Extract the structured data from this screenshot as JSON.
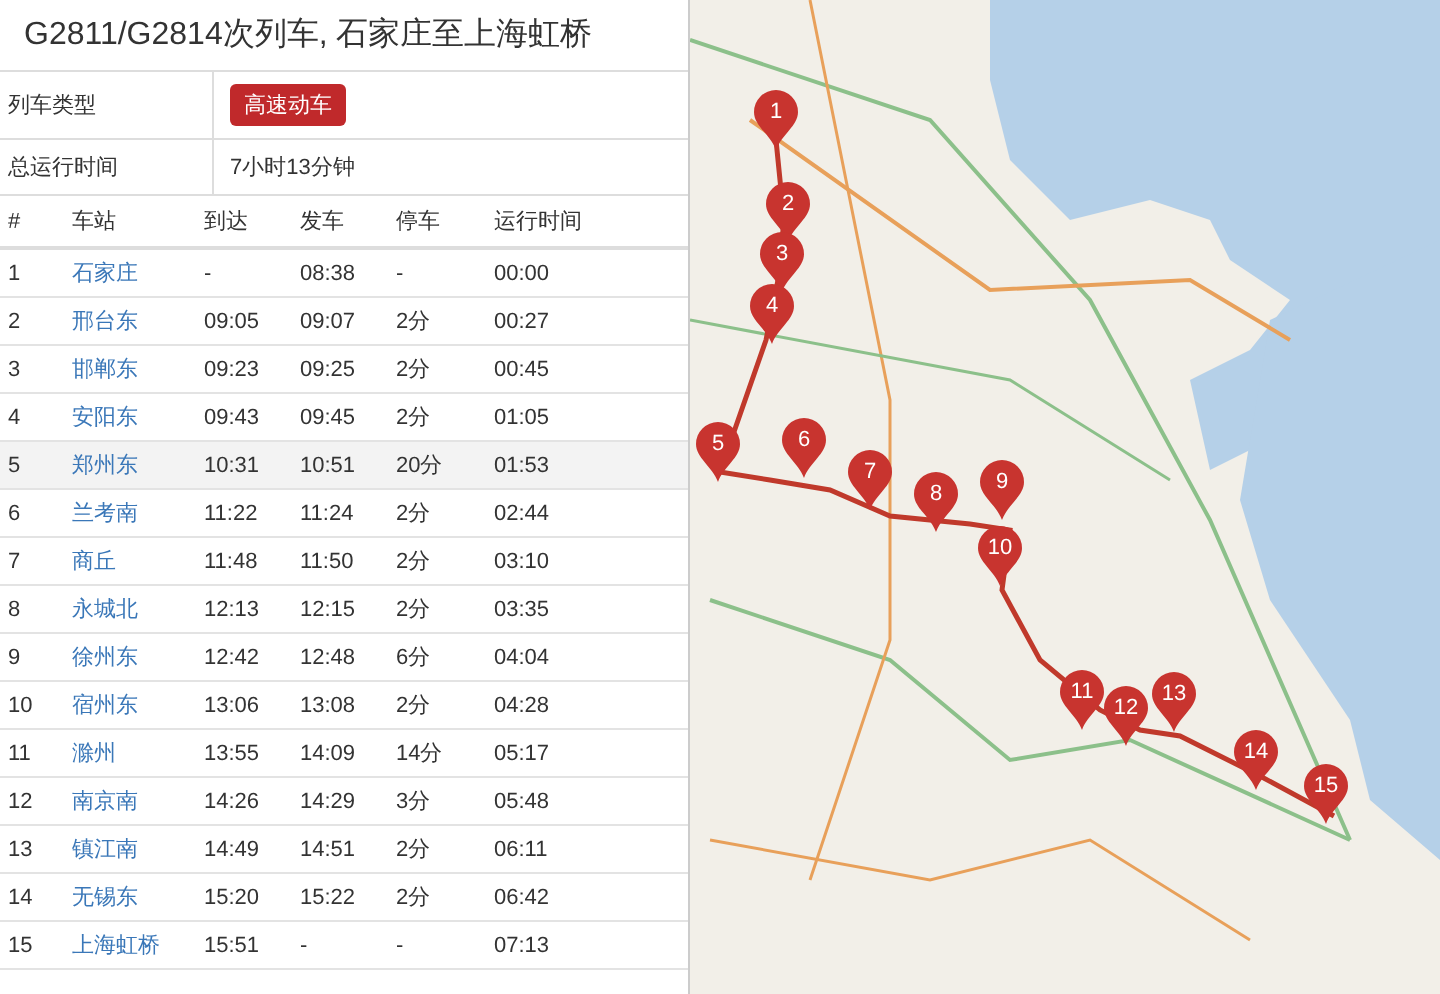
{
  "title": "G2811/G2814次列车, 石家庄至上海虹桥",
  "info": [
    {
      "label": "列车类型",
      "value": "高速动车",
      "kind": "badge"
    },
    {
      "label": "总运行时间",
      "value": "7小时13分钟",
      "kind": "text"
    }
  ],
  "table": {
    "columns": [
      "#",
      "车站",
      "到达",
      "发车",
      "停车",
      "运行时间"
    ],
    "rows": [
      {
        "cells": [
          "1",
          "石家庄",
          "-",
          "08:38",
          "-",
          "00:00"
        ],
        "selected": false
      },
      {
        "cells": [
          "2",
          "邢台东",
          "09:05",
          "09:07",
          "2分",
          "00:27"
        ],
        "selected": false
      },
      {
        "cells": [
          "3",
          "邯郸东",
          "09:23",
          "09:25",
          "2分",
          "00:45"
        ],
        "selected": false
      },
      {
        "cells": [
          "4",
          "安阳东",
          "09:43",
          "09:45",
          "2分",
          "01:05"
        ],
        "selected": false
      },
      {
        "cells": [
          "5",
          "郑州东",
          "10:31",
          "10:51",
          "20分",
          "01:53"
        ],
        "selected": true
      },
      {
        "cells": [
          "6",
          "兰考南",
          "11:22",
          "11:24",
          "2分",
          "02:44"
        ],
        "selected": false
      },
      {
        "cells": [
          "7",
          "商丘",
          "11:48",
          "11:50",
          "2分",
          "03:10"
        ],
        "selected": false
      },
      {
        "cells": [
          "8",
          "永城北",
          "12:13",
          "12:15",
          "2分",
          "03:35"
        ],
        "selected": false
      },
      {
        "cells": [
          "9",
          "徐州东",
          "12:42",
          "12:48",
          "6分",
          "04:04"
        ],
        "selected": false
      },
      {
        "cells": [
          "10",
          "宿州东",
          "13:06",
          "13:08",
          "2分",
          "04:28"
        ],
        "selected": false
      },
      {
        "cells": [
          "11",
          "滁州",
          "13:55",
          "14:09",
          "14分",
          "05:17"
        ],
        "selected": false
      },
      {
        "cells": [
          "12",
          "南京南",
          "14:26",
          "14:29",
          "3分",
          "05:48"
        ],
        "selected": false
      },
      {
        "cells": [
          "13",
          "镇江南",
          "14:49",
          "14:51",
          "2分",
          "06:11"
        ],
        "selected": false
      },
      {
        "cells": [
          "14",
          "无锡东",
          "15:20",
          "15:22",
          "2分",
          "06:42"
        ],
        "selected": false
      },
      {
        "cells": [
          "15",
          "上海虹桥",
          "15:51",
          "-",
          "-",
          "07:13"
        ],
        "selected": false
      }
    ]
  },
  "map": {
    "markers": [
      "1",
      "2",
      "3",
      "4",
      "5",
      "6",
      "7",
      "8",
      "9",
      "10",
      "11",
      "12",
      "13",
      "14",
      "15"
    ]
  }
}
